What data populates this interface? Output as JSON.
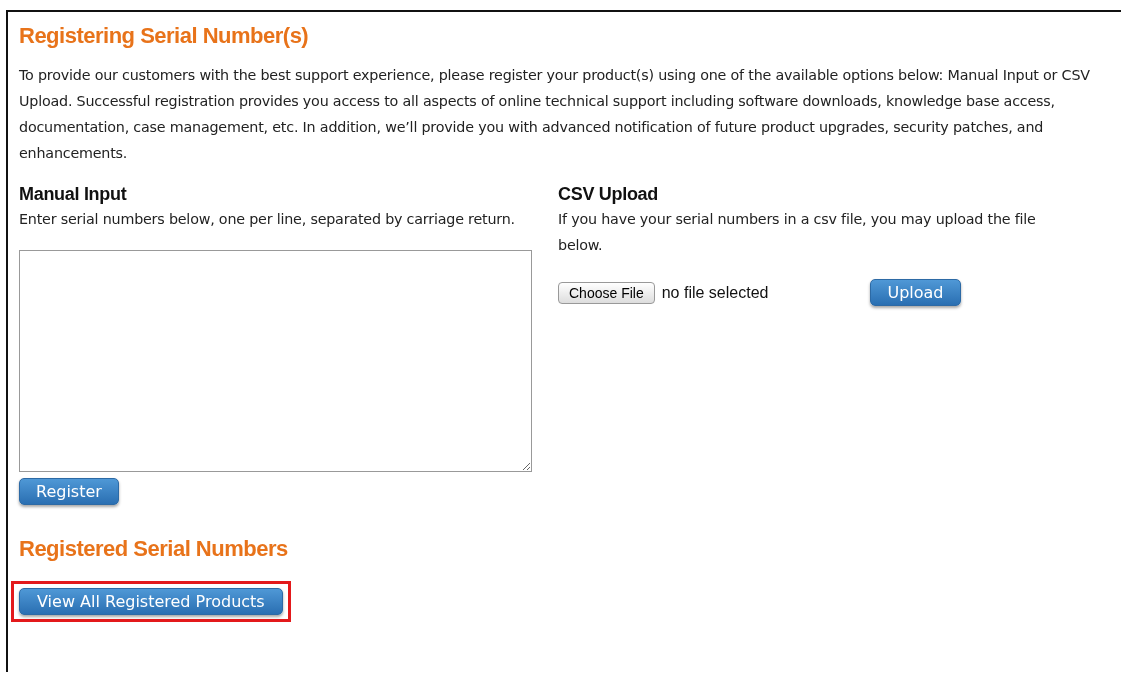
{
  "heading": "Registering Serial Number(s)",
  "intro": "To provide our customers with the best support experience, please register your product(s) using one of the available options below: Manual Input or CSV Upload. Successful registration provides you access to all aspects of online technical support including software downloads, knowledge base access, documentation, case management, etc. In addition, we’ll provide you with advanced notification of future product upgrades, security patches, and enhancements.",
  "manual_input": {
    "title": "Manual Input",
    "description": "Enter serial numbers below, one per line, separated by carriage return.",
    "button": "Register"
  },
  "csv_upload": {
    "title": "CSV Upload",
    "description": "If you have your serial numbers in a csv file, you may upload the file below.",
    "choose_button": "Choose File",
    "file_status": "no file selected",
    "button": "Upload"
  },
  "registered": {
    "heading": "Registered Serial Numbers",
    "button": {
      "label": "View All Registered Products",
      "highlighted": true
    }
  }
}
